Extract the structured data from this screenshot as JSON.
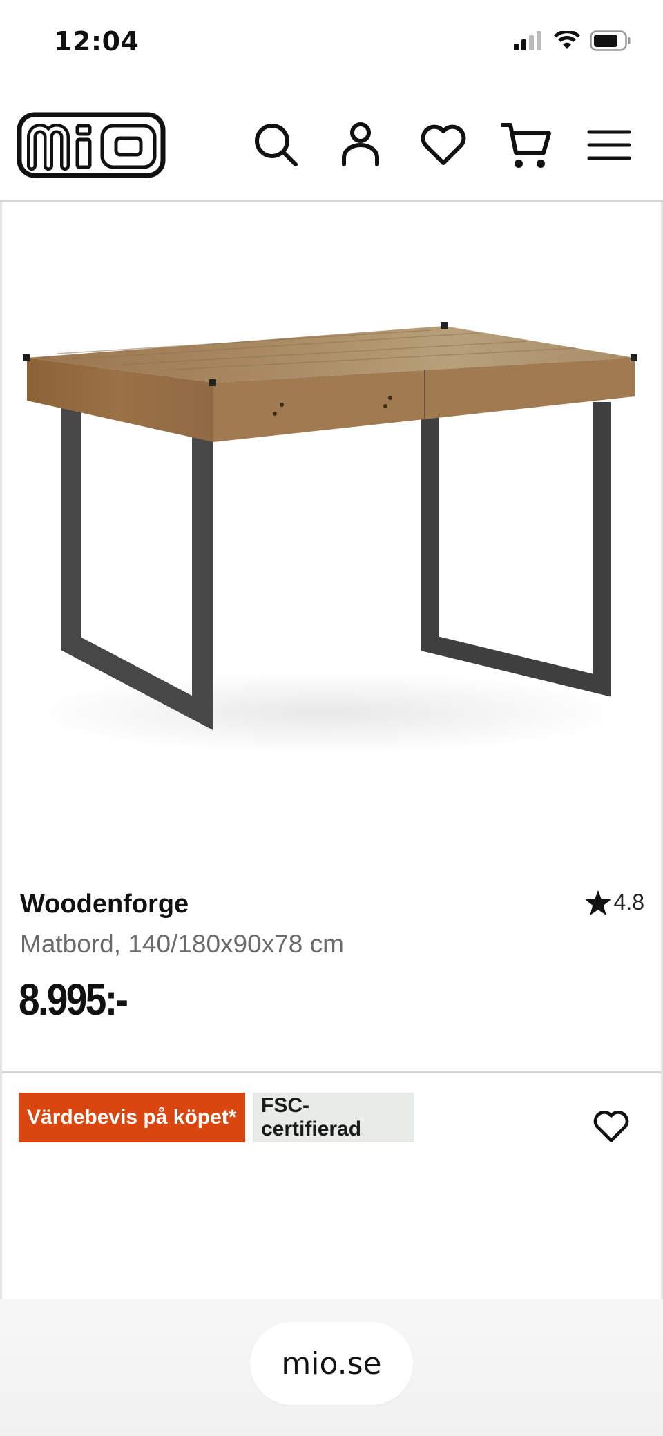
{
  "status_bar": {
    "time": "12:04",
    "icons": [
      "cellular-signal-icon",
      "wifi-icon",
      "battery-icon"
    ]
  },
  "header": {
    "logo_text": "mio",
    "icons": [
      "search-icon",
      "account-icon",
      "wishlist-heart-icon",
      "cart-icon",
      "menu-icon"
    ]
  },
  "product": {
    "name": "Woodenforge",
    "rating": "4.8",
    "description": "Matbord, 140/180x90x78 cm",
    "price": "8.995:-"
  },
  "badges": {
    "promo": "Värdebevis på köpet*",
    "fsc": "FSC-certifierad"
  },
  "browser": {
    "url": "mio.se"
  },
  "colors": {
    "promo_badge": "#d9460f",
    "fsc_badge": "#e8ece8",
    "text": "#111111",
    "muted_text": "#6b6b6b"
  }
}
